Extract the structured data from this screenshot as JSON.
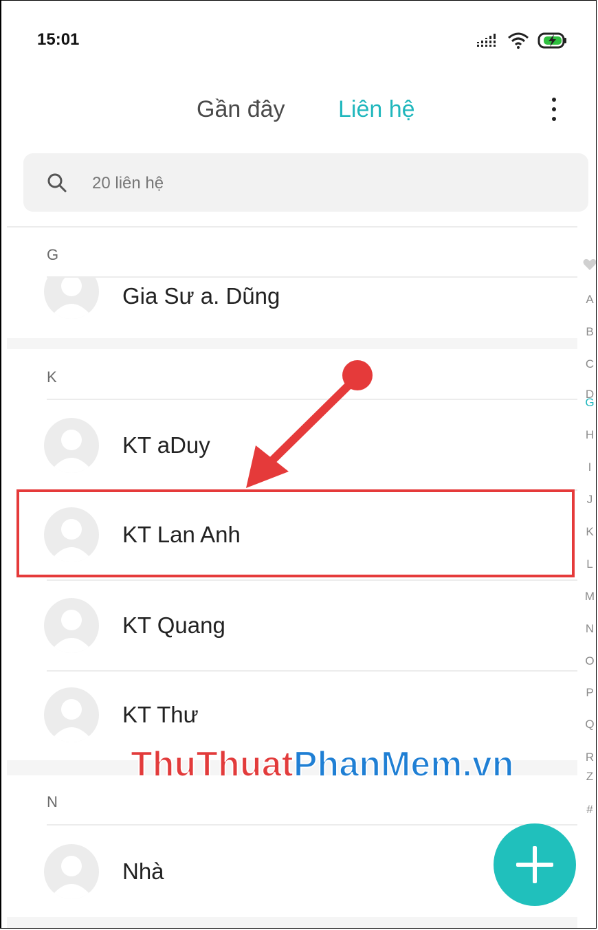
{
  "status_bar": {
    "time": "15:01",
    "icons": [
      "signal-icon",
      "wifi-icon",
      "battery-charging-icon"
    ]
  },
  "tabs": [
    {
      "label": "Gần đây",
      "active": false
    },
    {
      "label": "Liên hệ",
      "active": true
    }
  ],
  "menu_icon": "more-vertical-icon",
  "search": {
    "placeholder": "20 liên hệ",
    "icon": "search-icon"
  },
  "sections": [
    {
      "letter": "G",
      "contacts": [
        "Gia Sư a. Dũng"
      ]
    },
    {
      "letter": "K",
      "contacts": [
        "KT aDuy",
        "KT Lan Anh",
        "KT Quang",
        "KT Thư"
      ]
    },
    {
      "letter": "N",
      "contacts": [
        "Nhà"
      ]
    }
  ],
  "index_bar": [
    "heart-icon",
    "A",
    "B",
    "C",
    "D",
    "G",
    "H",
    "I",
    "J",
    "K",
    "L",
    "M",
    "N",
    "O",
    "P",
    "Q",
    "R",
    "Z",
    "#"
  ],
  "index_active": "G",
  "highlighted_contact": "KT Lan Anh",
  "watermark": {
    "part1": "ThuThuat",
    "part2": "PhanMem.vn"
  },
  "fab": {
    "icon": "plus-icon"
  },
  "colors": {
    "accent": "#20b7bd",
    "fab": "#20c0bc",
    "annotation": "#e53a3a"
  }
}
